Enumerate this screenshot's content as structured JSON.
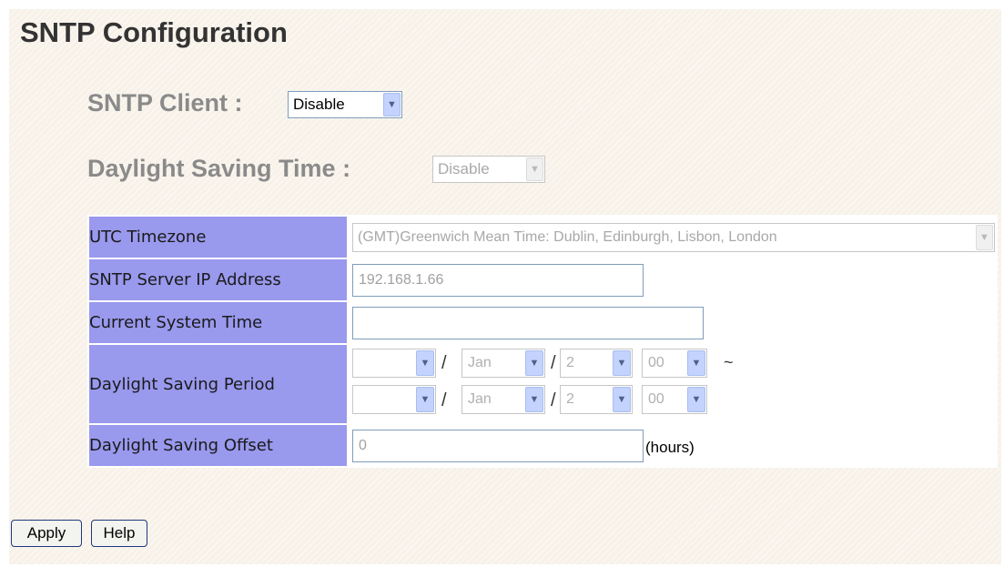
{
  "page": {
    "title": "SNTP Configuration"
  },
  "sntp_client": {
    "label": "SNTP Client :",
    "value": "Disable"
  },
  "daylight_saving": {
    "label": "Daylight Saving Time :",
    "value": "Disable"
  },
  "table": {
    "utc_timezone": {
      "label": "UTC Timezone",
      "value": "(GMT)Greenwich Mean Time: Dublin, Edinburgh, Lisbon, London"
    },
    "server_ip": {
      "label": "SNTP Server IP Address",
      "value": "192.168.1.66"
    },
    "current_time": {
      "label": "Current System Time",
      "value": ""
    },
    "period": {
      "label": "Daylight Saving Period",
      "start": {
        "year": "",
        "month": "Jan",
        "day": "2",
        "hour": "00"
      },
      "end": {
        "year": "",
        "month": "Jan",
        "day": "2",
        "hour": "00"
      },
      "separator": "/",
      "range_symbol": "~"
    },
    "offset": {
      "label": "Daylight Saving Offset",
      "value": "0",
      "unit": "(hours)"
    }
  },
  "buttons": {
    "apply": "Apply",
    "help": "Help"
  },
  "icons": {
    "dropdown": "chevron-down-icon"
  },
  "colors": {
    "label_bg": "#9999ee",
    "panel_bg": "#f7f1e8",
    "input_border": "#7f9db9"
  }
}
